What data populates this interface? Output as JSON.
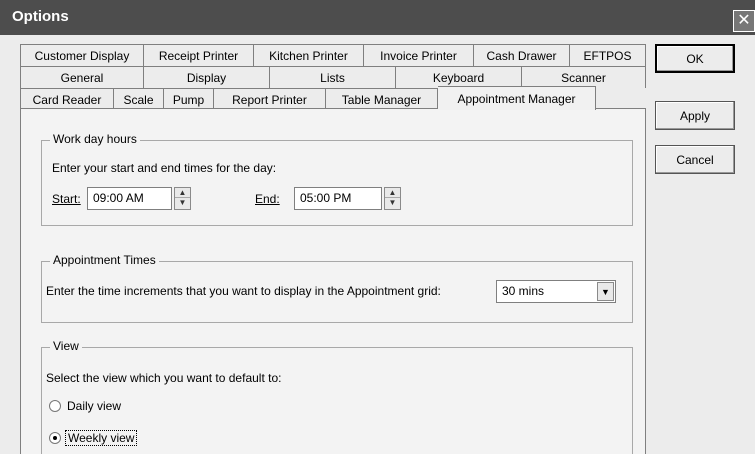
{
  "window": {
    "title": "Options",
    "close_glyph": "✕"
  },
  "tabs": {
    "row1": [
      "Customer Display",
      "Receipt Printer",
      "Kitchen Printer",
      "Invoice Printer",
      "Cash Drawer",
      "EFTPOS"
    ],
    "row2": [
      "General",
      "Display",
      "Lists",
      "Keyboard",
      "Scanner"
    ],
    "row3": [
      "Card Reader",
      "Scale",
      "Pump",
      "Report Printer",
      "Table Manager",
      "Appointment Manager"
    ],
    "active": "Appointment Manager"
  },
  "work_day": {
    "legend": "Work day hours",
    "instruction": "Enter your start and end times for the day:",
    "start_label": "Start:",
    "start_value": "09:00 AM",
    "end_label": "End:",
    "end_value": "05:00 PM"
  },
  "appointment_times": {
    "legend": "Appointment Times",
    "instruction": "Enter the time increments that you want to display in the Appointment grid:",
    "increment_value": "30 mins"
  },
  "view": {
    "legend": "View",
    "instruction": "Select the view which you want to default to:",
    "daily_label": "Daily view",
    "weekly_label": "Weekly view",
    "selected": "Weekly view"
  },
  "buttons": {
    "ok": "OK",
    "apply": "Apply",
    "cancel": "Cancel"
  }
}
